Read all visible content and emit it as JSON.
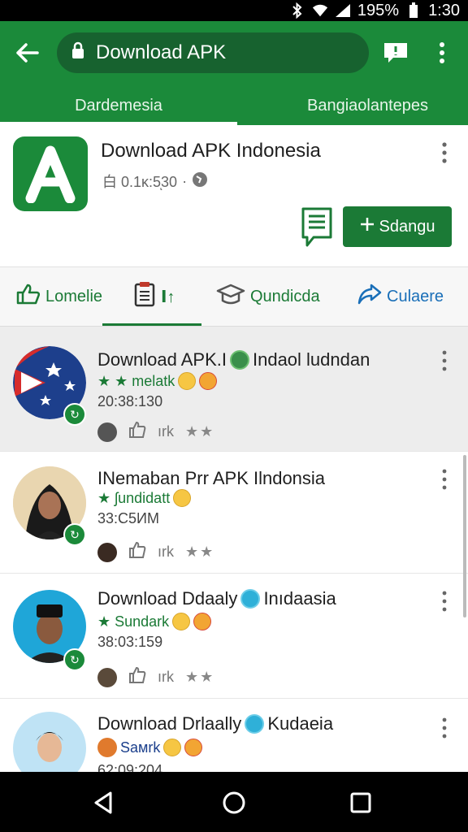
{
  "status": {
    "battery": "195%",
    "time": "1:30"
  },
  "appbar": {
    "url_text": "Download APK",
    "tabs": [
      {
        "label": "Dardemesia"
      },
      {
        "label": "Bangiaolantepes"
      }
    ]
  },
  "app": {
    "title": "Download APK Indonesia",
    "meta": "⽩ 0.1ĸ:5ͅ30",
    "add_button": "Sdangu"
  },
  "subtabs": [
    {
      "label": "Lomelie",
      "icon": "thumb-up-icon"
    },
    {
      "label": "Ⅰ↑",
      "icon": "notes-icon"
    },
    {
      "label": "Qundicda",
      "icon": "graduation-cap-icon"
    },
    {
      "label": "Culaere",
      "icon": "share-icon"
    }
  ],
  "items": [
    {
      "title_a": "Download APK.I",
      "title_b": "Indaol ludndan",
      "sub": "★ ★ melаtk",
      "time": "20:38:130",
      "action": "ırk",
      "stars": "★★"
    },
    {
      "title_a": "INemaban Prr APK Ilndonsia",
      "title_b": "",
      "sub": "★ ʃundidatt",
      "time": "33:C5ИΜ",
      "action": "ırk",
      "stars": "★★"
    },
    {
      "title_a": "Download Ddaaly",
      "title_b": "Inıdaasia",
      "sub": "★ Sundark",
      "time": "38:03:159",
      "action": "ırk",
      "stars": "★★"
    },
    {
      "title_a": "Download Drlaally",
      "title_b": "Kudaeia",
      "sub": "Saмrk",
      "time": "62:09:204",
      "action": "",
      "stars": ""
    }
  ],
  "colors": {
    "primary": "#1b8a3a",
    "primary_dark": "#17622f",
    "link_blue": "#1a6fb8"
  }
}
